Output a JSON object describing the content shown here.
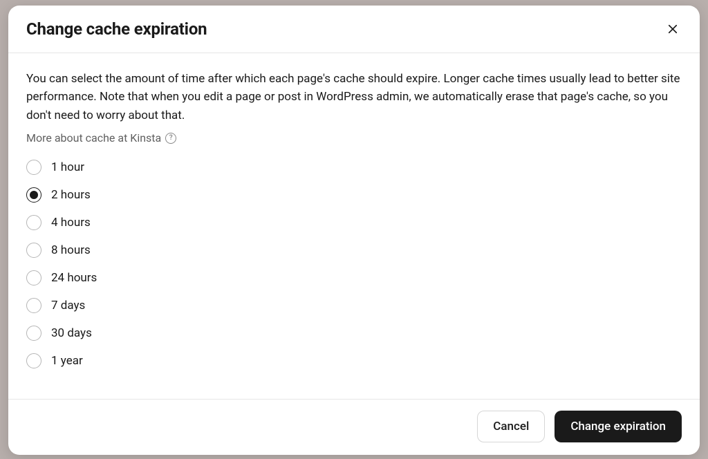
{
  "modal": {
    "title": "Change cache expiration",
    "description": "You can select the amount of time after which each page's cache should expire. Longer cache times usually lead to better site performance. Note that when you edit a page or post in WordPress admin, we automatically erase that page's cache, so you don't need to worry about that.",
    "help_link": "More about cache at Kinsta",
    "options": [
      {
        "label": "1 hour",
        "selected": false
      },
      {
        "label": "2 hours",
        "selected": true
      },
      {
        "label": "4 hours",
        "selected": false
      },
      {
        "label": "8 hours",
        "selected": false
      },
      {
        "label": "24 hours",
        "selected": false
      },
      {
        "label": "7 days",
        "selected": false
      },
      {
        "label": "30 days",
        "selected": false
      },
      {
        "label": "1 year",
        "selected": false
      }
    ],
    "buttons": {
      "cancel": "Cancel",
      "confirm": "Change expiration"
    }
  }
}
